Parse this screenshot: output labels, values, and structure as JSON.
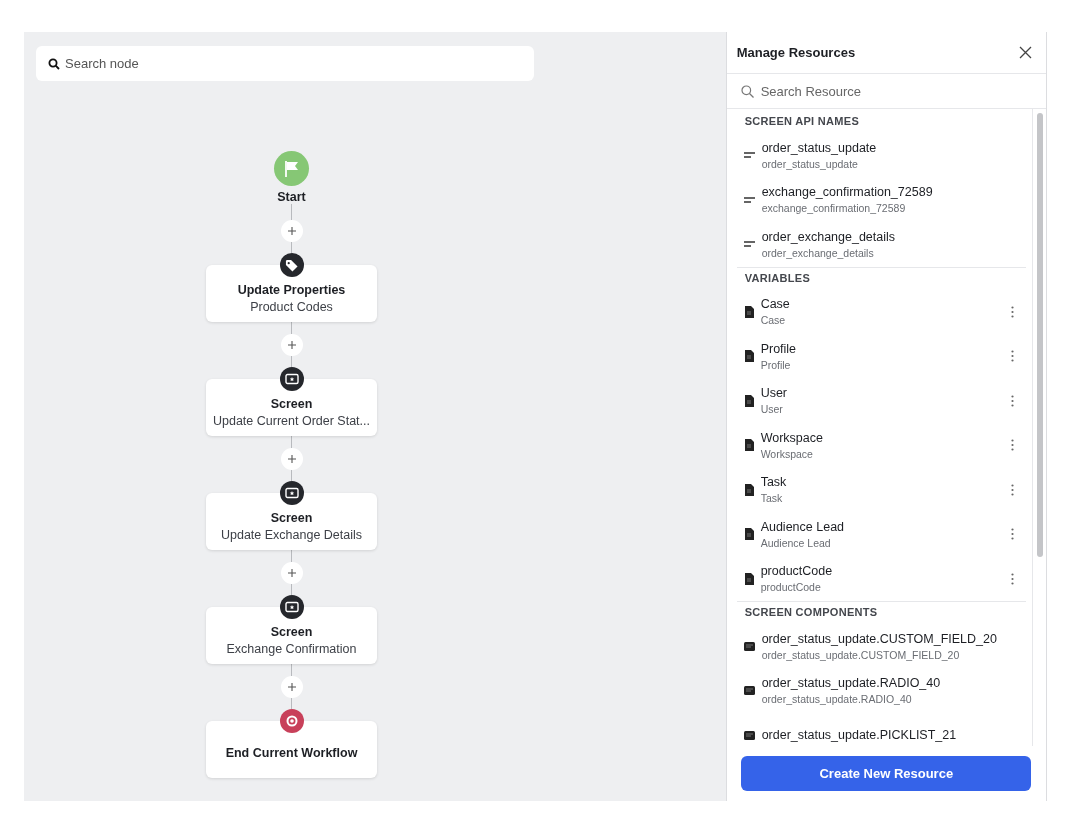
{
  "canvas": {
    "search": {
      "placeholder": "Search node"
    },
    "flow": [
      {
        "kind": "start",
        "title": "Start"
      },
      {
        "kind": "properties",
        "title": "Update Properties",
        "subtitle": "Product Codes"
      },
      {
        "kind": "screen",
        "title": "Screen",
        "subtitle": "Update Current Order Stat..."
      },
      {
        "kind": "screen",
        "title": "Screen",
        "subtitle": "Update Exchange Details"
      },
      {
        "kind": "screen",
        "title": "Screen",
        "subtitle": "Exchange Confirmation"
      },
      {
        "kind": "end",
        "title": "End Current Workflow"
      }
    ]
  },
  "panel": {
    "title": "Manage Resources",
    "search": {
      "placeholder": "Search Resource"
    },
    "sections": [
      {
        "heading": "SCREEN API NAMES",
        "items": [
          {
            "kind": "api_name",
            "title": "order_status_update",
            "subtitle": "order_status_update"
          },
          {
            "kind": "api_name",
            "title": "exchange_confirmation_72589",
            "subtitle": "exchange_confirmation_72589"
          },
          {
            "kind": "api_name",
            "title": "order_exchange_details",
            "subtitle": "order_exchange_details"
          }
        ]
      },
      {
        "heading": "VARIABLES",
        "items": [
          {
            "kind": "variable",
            "title": "Case",
            "subtitle": "Case"
          },
          {
            "kind": "variable",
            "title": "Profile",
            "subtitle": "Profile"
          },
          {
            "kind": "variable",
            "title": "User",
            "subtitle": "User"
          },
          {
            "kind": "variable",
            "title": "Workspace",
            "subtitle": "Workspace"
          },
          {
            "kind": "variable",
            "title": "Task",
            "subtitle": "Task"
          },
          {
            "kind": "variable",
            "title": "Audience Lead",
            "subtitle": "Audience Lead"
          },
          {
            "kind": "variable",
            "title": "productCode",
            "subtitle": "productCode"
          }
        ]
      },
      {
        "heading": "SCREEN COMPONENTS",
        "items": [
          {
            "kind": "component",
            "title": "order_status_update.CUSTOM_FIELD_20",
            "subtitle": "order_status_update.CUSTOM_FIELD_20"
          },
          {
            "kind": "component",
            "title": "order_status_update.RADIO_40",
            "subtitle": "order_status_update.RADIO_40"
          },
          {
            "kind": "component",
            "title": "order_status_update.PICKLIST_21"
          }
        ]
      }
    ],
    "button": "Create New Resource"
  }
}
